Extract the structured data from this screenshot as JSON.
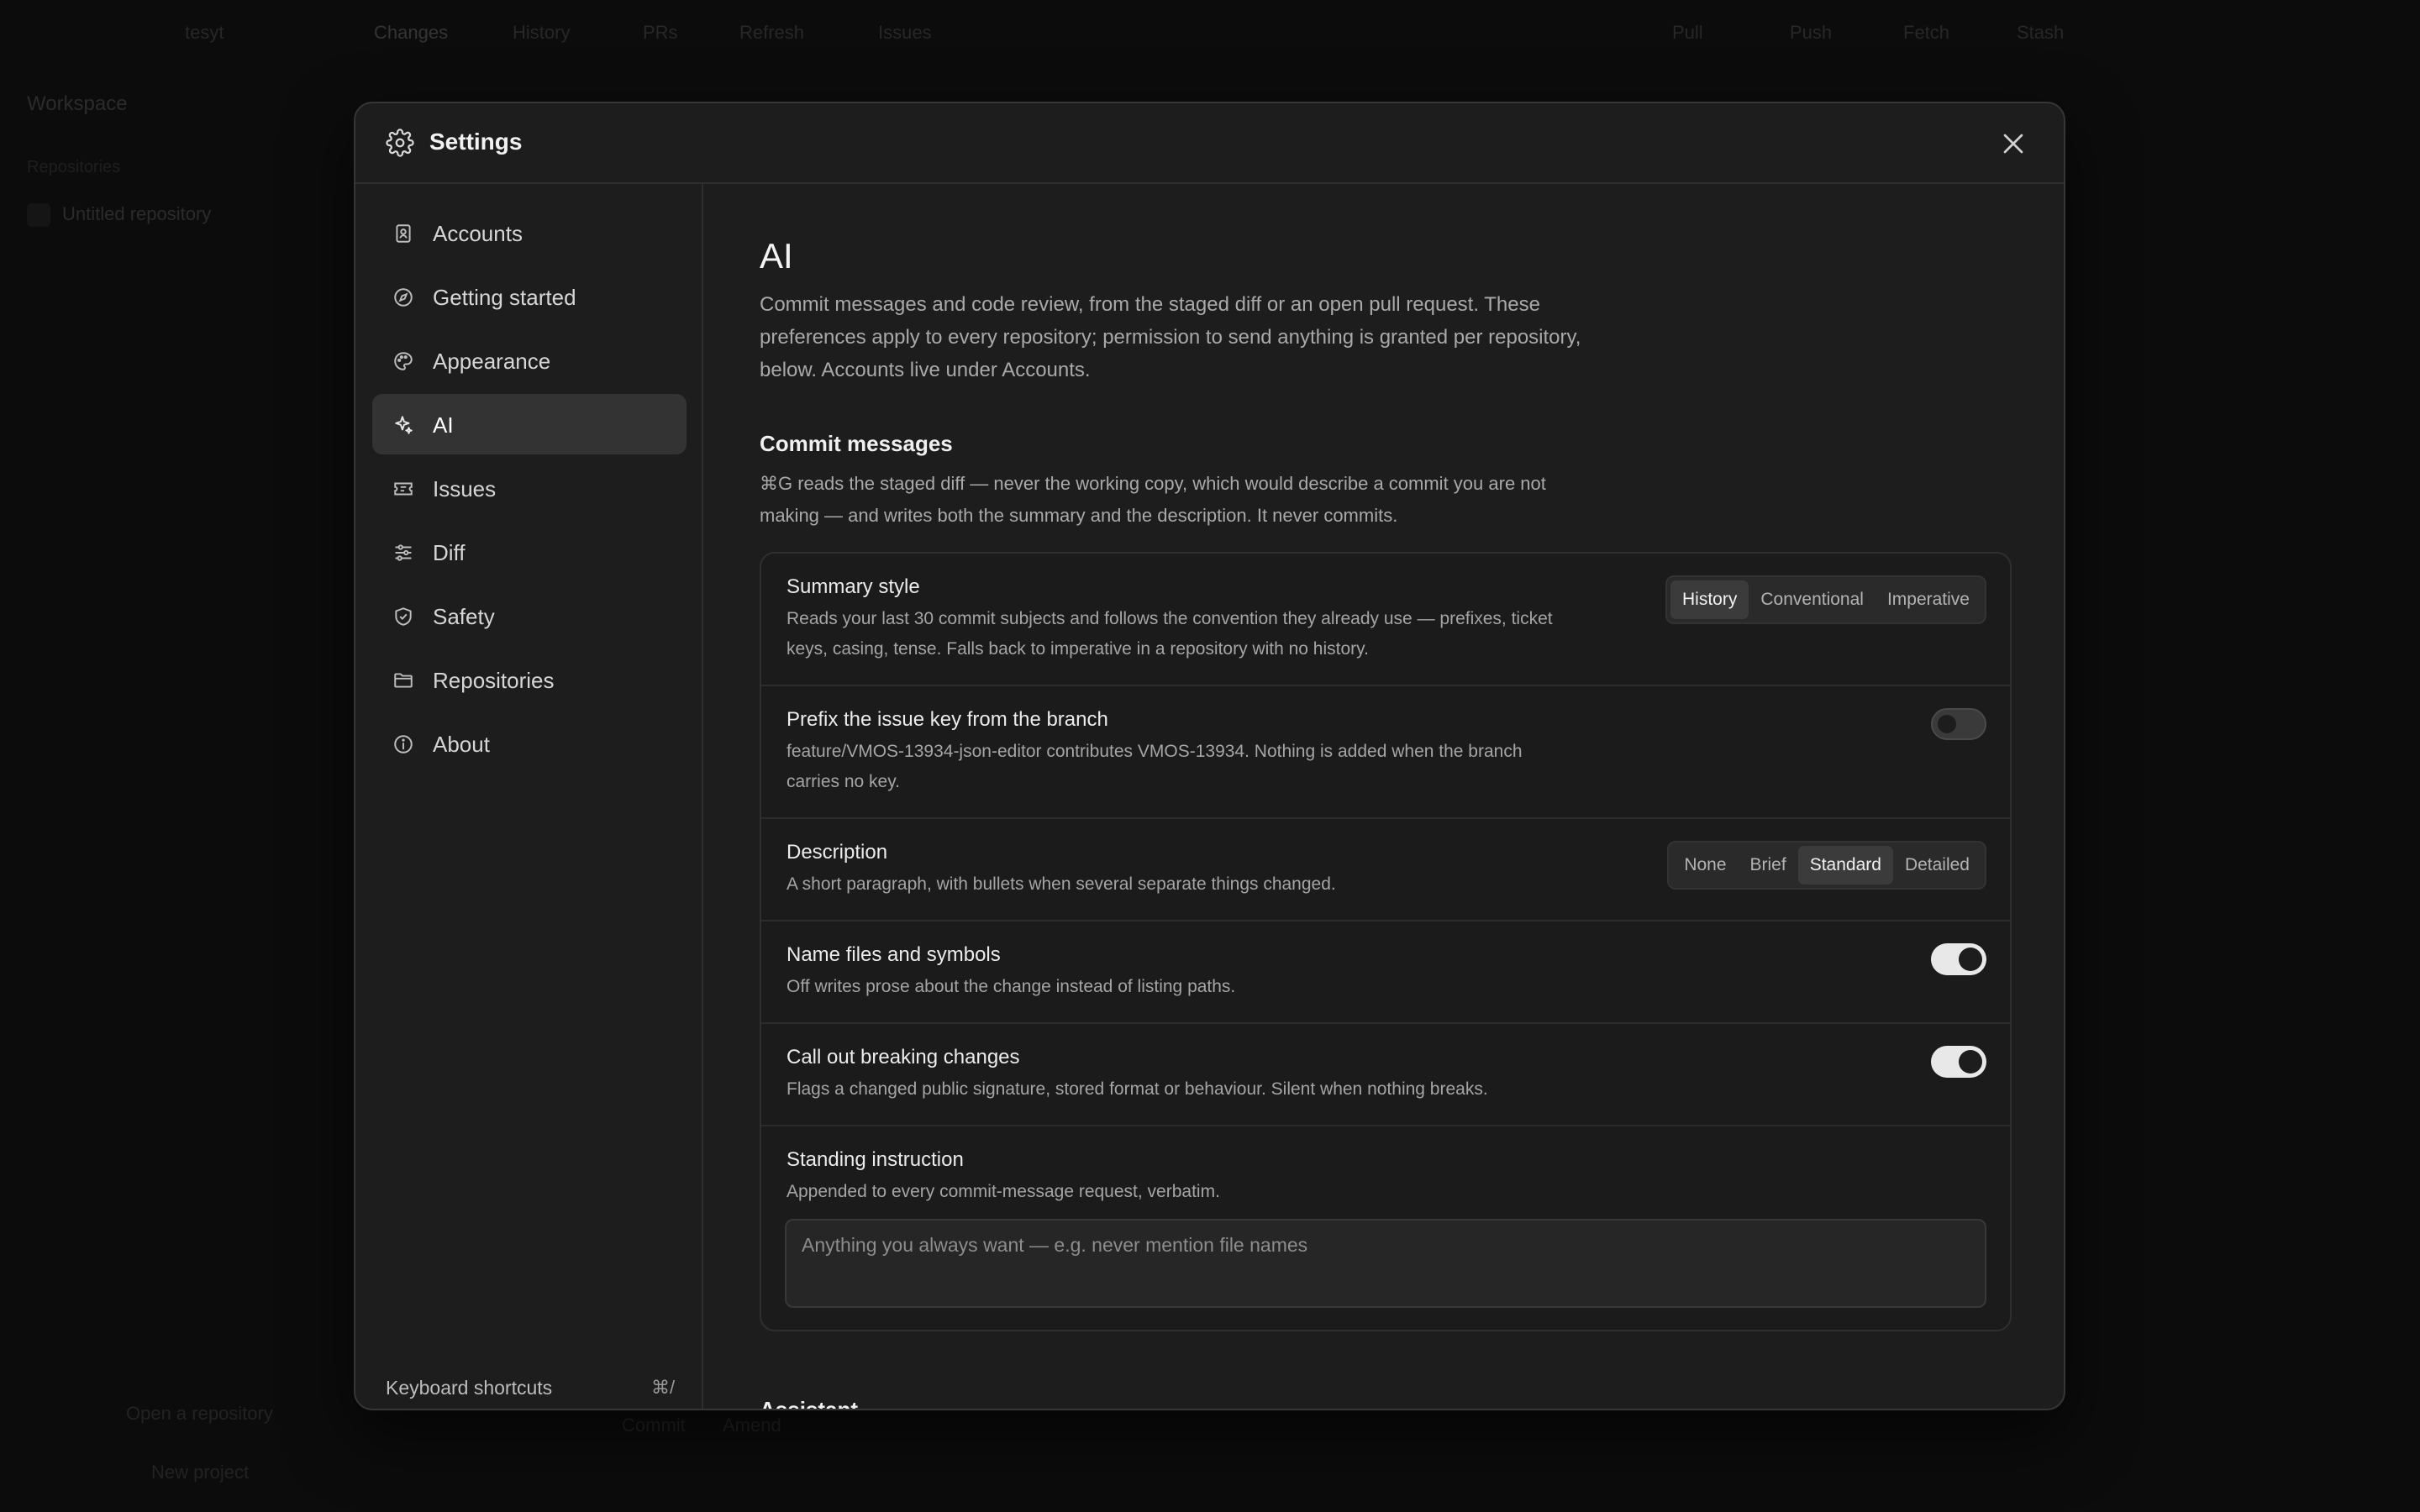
{
  "background": {
    "toolbar_items": [
      "tesyt",
      "Changes",
      "History",
      "PRs",
      "Refresh",
      "Issues",
      "Pull",
      "Push",
      "Fetch",
      "Stash"
    ],
    "sidebar_title": "Workspace",
    "sidebar_subtitle": "Repositories",
    "sidebar_row": "Untitled repository",
    "bottom_left_1": "Open a repository",
    "bottom_left_2": "New project",
    "bottom_tabs": [
      "Commit",
      "Amend"
    ]
  },
  "modal": {
    "title": "Settings",
    "close_label": "Close"
  },
  "nav": {
    "items": [
      {
        "label": "Accounts",
        "icon": "user-card-icon"
      },
      {
        "label": "Getting started",
        "icon": "compass-icon"
      },
      {
        "label": "Appearance",
        "icon": "palette-icon"
      },
      {
        "label": "AI",
        "icon": "sparkle-icon",
        "active": true
      },
      {
        "label": "Issues",
        "icon": "ticket-icon"
      },
      {
        "label": "Diff",
        "icon": "sliders-icon"
      },
      {
        "label": "Safety",
        "icon": "shield-icon"
      },
      {
        "label": "Repositories",
        "icon": "folder-icon"
      },
      {
        "label": "About",
        "icon": "info-icon"
      }
    ],
    "footer_label": "Keyboard shortcuts",
    "footer_key": "⌘/"
  },
  "content": {
    "title": "AI",
    "intro": "Commit messages and code review, from the staged diff or an open pull request. These preferences apply to every repository; permission to send anything is granted per repository, below. Accounts live under Accounts.",
    "section_title": "Commit messages",
    "section_desc": "⌘G reads the staged diff — never the working copy, which would describe a commit you are not making — and writes both the summary and the description. It never commits.",
    "rows": {
      "summary": {
        "title": "Summary style",
        "desc": "Reads your last 30 commit subjects and follows the convention they already use — prefixes, ticket keys, casing, tense. Falls back to imperative in a repository with no history.",
        "options": [
          "History",
          "Conventional",
          "Imperative"
        ],
        "selected": "History"
      },
      "prefix": {
        "title": "Prefix the issue key from the branch",
        "desc": "feature/VMOS-13934-json-editor contributes VMOS-13934. Nothing is added when the branch carries no key.",
        "enabled": false
      },
      "description": {
        "title": "Description",
        "desc": "A short paragraph, with bullets when several separate things changed.",
        "options": [
          "None",
          "Brief",
          "Standard",
          "Detailed"
        ],
        "selected": "Standard"
      },
      "name_files": {
        "title": "Name files and symbols",
        "desc": "Off writes prose about the change instead of listing paths.",
        "enabled": true
      },
      "breaking": {
        "title": "Call out breaking changes",
        "desc": "Flags a changed public signature, stored format or behaviour. Silent when nothing breaks.",
        "enabled": true
      },
      "standing": {
        "title": "Standing instruction",
        "desc": "Appended to every commit-message request, verbatim.",
        "value": "",
        "placeholder": "Anything you always want — e.g. never mention file names"
      }
    },
    "next_section_title": "Assistant"
  }
}
